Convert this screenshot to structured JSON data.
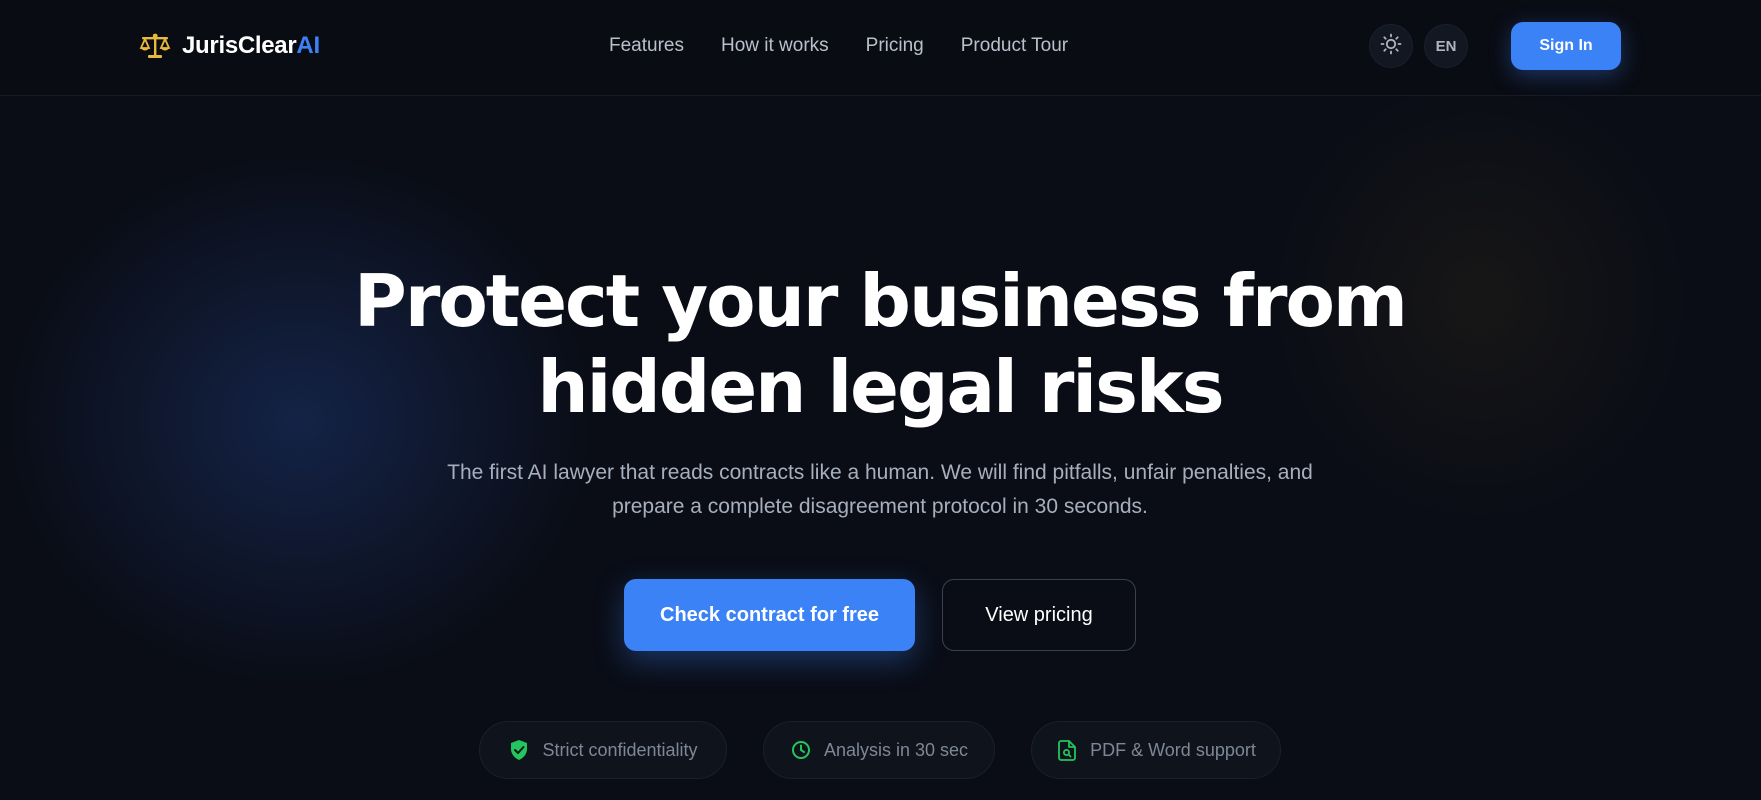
{
  "header": {
    "logo": {
      "part1": "JurisClear",
      "part2": "AI",
      "icon": "scales-icon"
    },
    "nav": [
      {
        "label": "Features"
      },
      {
        "label": "How it works"
      },
      {
        "label": "Pricing"
      },
      {
        "label": "Product Tour"
      }
    ],
    "theme_toggle_icon": "sun-icon",
    "language": "EN",
    "sign_in_label": "Sign In"
  },
  "hero": {
    "title_line1": "Protect your business from",
    "title_line2": "hidden legal risks",
    "subtitle_line1": "The first AI lawyer that reads contracts like a human. We will find pitfalls, unfair penalties, and",
    "subtitle_line2": "prepare a complete disagreement protocol in 30 seconds.",
    "primary_cta": "Check contract for free",
    "secondary_cta": "View pricing"
  },
  "badges": [
    {
      "label": "Strict confidentiality",
      "icon": "shield-check-icon"
    },
    {
      "label": "Analysis in 30 sec",
      "icon": "clock-icon"
    },
    {
      "label": "PDF & Word support",
      "icon": "document-search-icon"
    }
  ],
  "colors": {
    "accent": "#3b82f6",
    "logo_gold": "#e8b93a",
    "badge_icon_green": "#22c55e",
    "background": "#0a0d16"
  }
}
